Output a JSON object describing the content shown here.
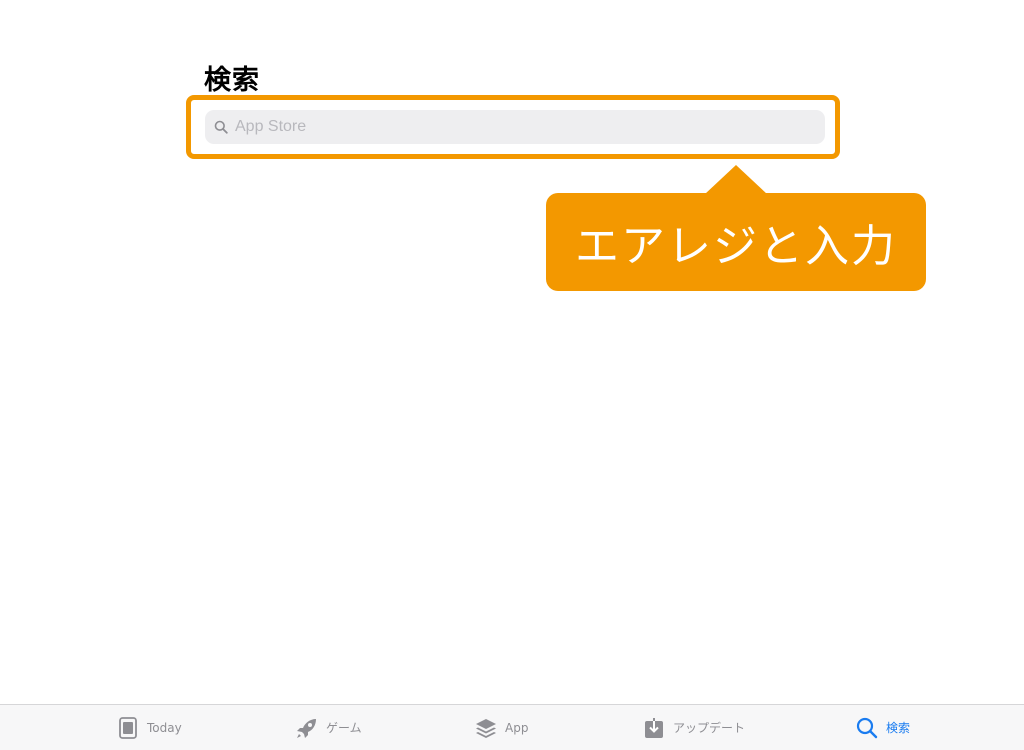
{
  "page": {
    "title": "検索"
  },
  "search": {
    "placeholder": "App Store",
    "value": ""
  },
  "callout": {
    "text": "エアレジと入力",
    "color": "#f39800"
  },
  "tab_bar": {
    "tabs": [
      {
        "label": "Today",
        "icon": "today-icon",
        "active": false
      },
      {
        "label": "ゲーム",
        "icon": "rocket-icon",
        "active": false
      },
      {
        "label": "App",
        "icon": "apps-stack-icon",
        "active": false
      },
      {
        "label": "アップデート",
        "icon": "download-icon",
        "active": false
      },
      {
        "label": "検索",
        "icon": "search-icon",
        "active": true
      }
    ],
    "active_color": "#1a7cf0",
    "inactive_color": "#8e8e93"
  }
}
